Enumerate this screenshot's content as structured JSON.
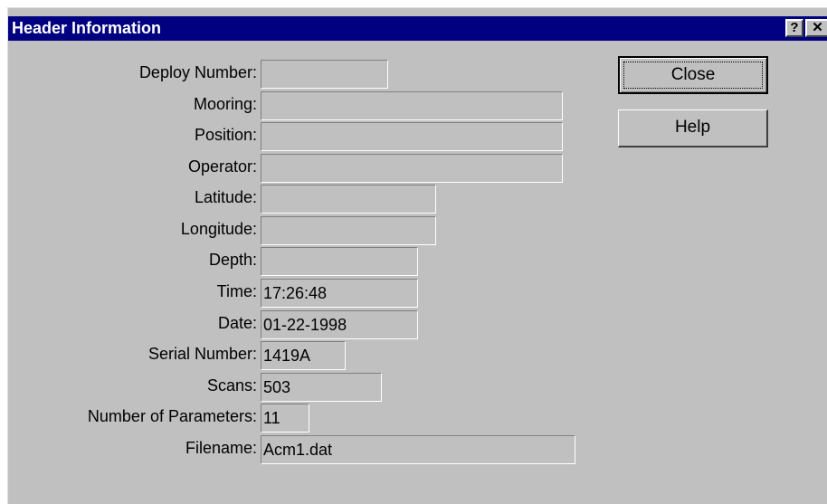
{
  "dialog": {
    "title": "Header Information",
    "help_glyph": "?",
    "close_glyph": "✕"
  },
  "fields": [
    {
      "label": "Deploy Number:",
      "value": ""
    },
    {
      "label": "Mooring:",
      "value": ""
    },
    {
      "label": "Position:",
      "value": ""
    },
    {
      "label": "Operator:",
      "value": ""
    },
    {
      "label": "Latitude:",
      "value": ""
    },
    {
      "label": "Longitude:",
      "value": ""
    },
    {
      "label": "Depth:",
      "value": ""
    },
    {
      "label": "Time:",
      "value": "17:26:48"
    },
    {
      "label": "Date:",
      "value": "01-22-1998"
    },
    {
      "label": "Serial Number:",
      "value": "1419A"
    },
    {
      "label": "Scans:",
      "value": "503"
    },
    {
      "label": "Number of Parameters:",
      "value": "11"
    },
    {
      "label": "Filename:",
      "value": "Acm1.dat"
    }
  ],
  "buttons": {
    "close_label": "Close",
    "help_label": "Help"
  }
}
